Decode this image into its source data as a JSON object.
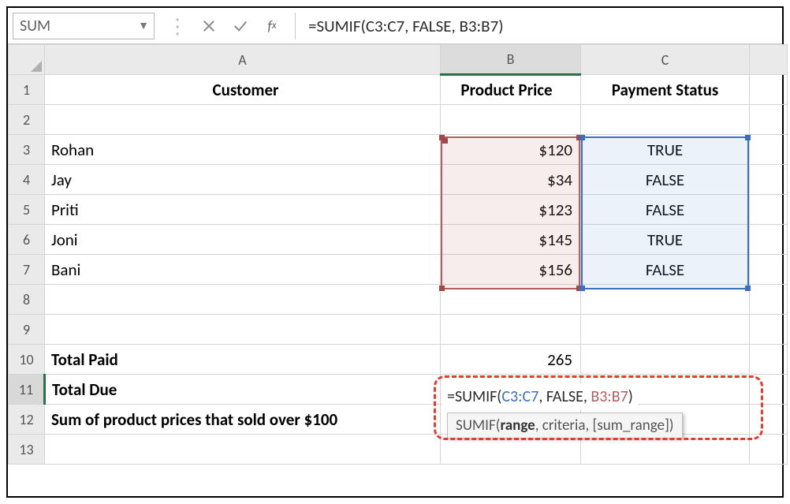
{
  "nameBox": "SUM",
  "formulaBar": "=SUMIF(C3:C7, FALSE, B3:B7)",
  "columns": {
    "a": "A",
    "b": "B",
    "c": "C"
  },
  "headers": {
    "customer": "Customer",
    "price": "Product Price",
    "status": "Payment Status"
  },
  "rows": [
    {
      "n": 3,
      "customer": "Rohan",
      "price": "$120",
      "status": "TRUE"
    },
    {
      "n": 4,
      "customer": "Jay",
      "price": "$34",
      "status": "FALSE"
    },
    {
      "n": 5,
      "customer": "Priti",
      "price": "$123",
      "status": "FALSE"
    },
    {
      "n": 6,
      "customer": "Joni",
      "price": "$145",
      "status": "TRUE"
    },
    {
      "n": 7,
      "customer": "Bani",
      "price": "$156",
      "status": "FALSE"
    }
  ],
  "summary": {
    "totalPaidLabel": "Total Paid",
    "totalPaidValue": "265",
    "totalDueLabel": "Total Due",
    "sumOverLabel": "Sum of product prices that sold over $100"
  },
  "editingFormula": {
    "prefix": "=SUMIF(",
    "rangeC": "C3:C7",
    "sep1": ", FALSE, ",
    "rangeB": "B3:B7",
    "suffix": ")"
  },
  "tooltip": {
    "fn": "SUMIF(",
    "arg1": "range",
    "rest": ", criteria, [sum_range])"
  },
  "chart_data": {
    "type": "table",
    "columns": [
      "Customer",
      "Product Price",
      "Payment Status"
    ],
    "rows": [
      [
        "Rohan",
        120,
        true
      ],
      [
        "Jay",
        34,
        false
      ],
      [
        "Priti",
        123,
        false
      ],
      [
        "Joni",
        145,
        true
      ],
      [
        "Bani",
        156,
        false
      ]
    ],
    "totals": {
      "Total Paid": 265
    }
  }
}
